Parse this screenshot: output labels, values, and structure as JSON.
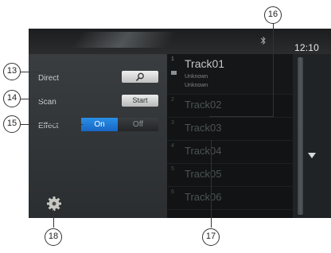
{
  "status": {
    "time": "12:10"
  },
  "settings": {
    "direct_label": "Direct",
    "scan_label": "Scan",
    "scan_button": "Start",
    "effect_label": "Effect",
    "effect_on": "On",
    "effect_off": "Off"
  },
  "tracks": [
    {
      "num": "1",
      "name": "Track01",
      "artist": "Unknown",
      "album": "Unknown",
      "active": true
    },
    {
      "num": "2",
      "name": "Track02"
    },
    {
      "num": "3",
      "name": "Track03"
    },
    {
      "num": "4",
      "name": "Track04"
    },
    {
      "num": "5",
      "name": "Track05"
    },
    {
      "num": "6",
      "name": "Track06"
    }
  ],
  "callouts": [
    "13",
    "14",
    "15",
    "16",
    "17",
    "18"
  ],
  "icons": {
    "bluetooth": "bluetooth-icon",
    "search": "search-icon",
    "settings": "gear-icon",
    "scroll_down": "chevron-down-icon"
  }
}
